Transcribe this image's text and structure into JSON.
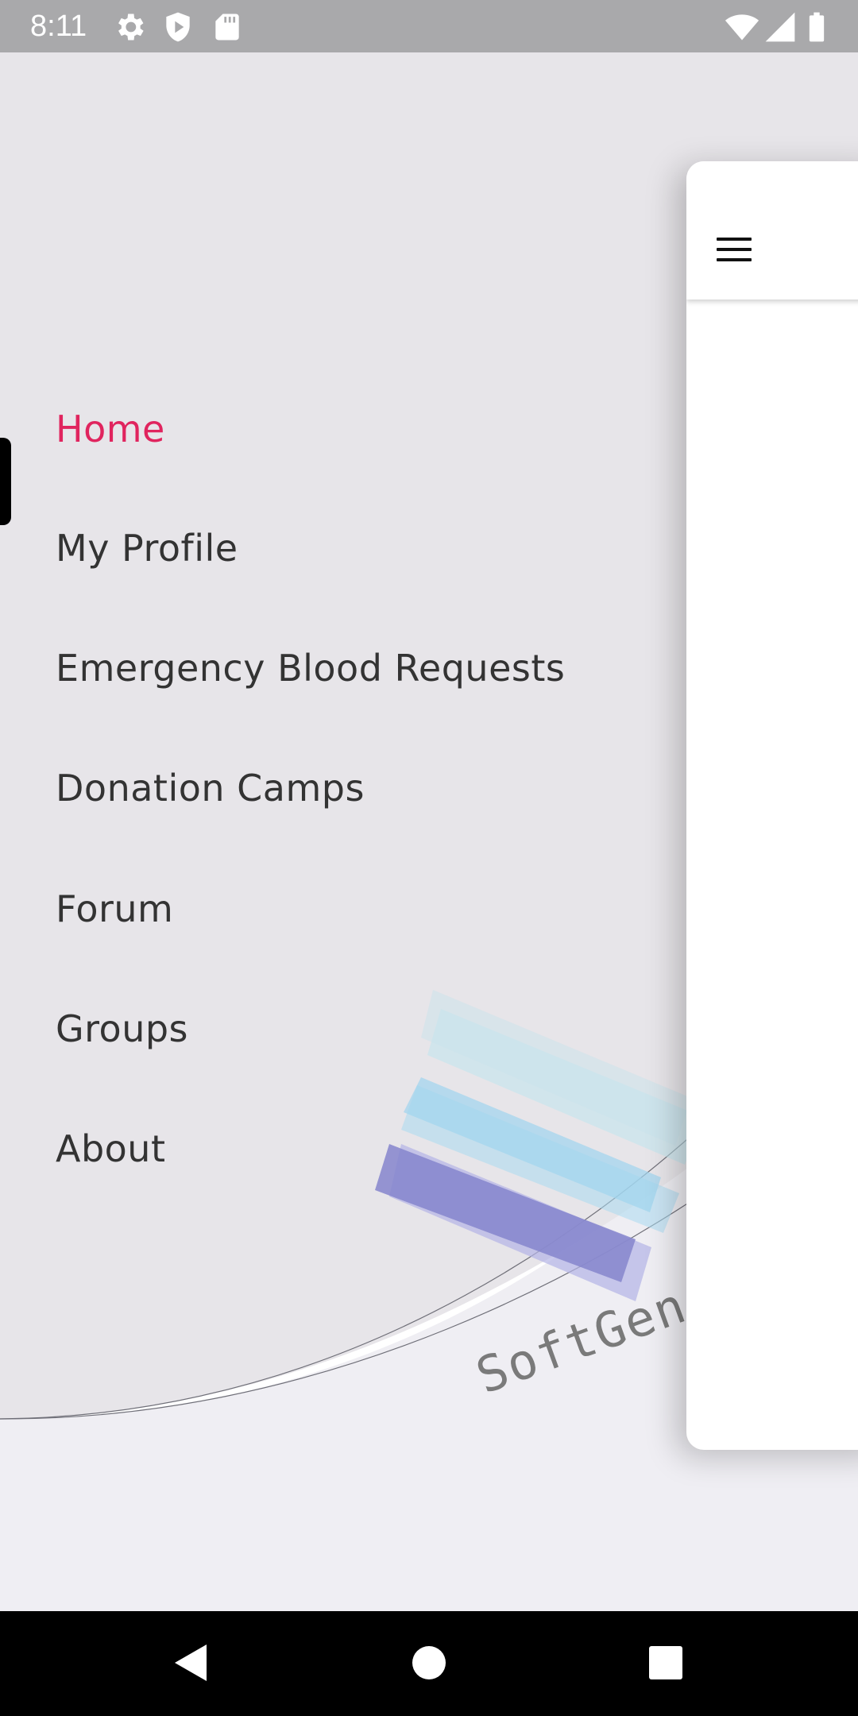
{
  "status_bar": {
    "time": "8:11",
    "left_icons": [
      "gear-icon",
      "shield-icon",
      "sd-card-icon"
    ],
    "right_icons": [
      "wifi-icon",
      "signal-icon",
      "battery-icon"
    ]
  },
  "drawer": {
    "items": [
      {
        "label": "Home",
        "active": true
      },
      {
        "label": "My Profile",
        "active": false
      },
      {
        "label": "Emergency Blood Requests",
        "active": false
      },
      {
        "label": "Donation Camps",
        "active": false
      },
      {
        "label": "Forum",
        "active": false
      },
      {
        "label": "Groups",
        "active": false
      },
      {
        "label": "About",
        "active": false
      }
    ],
    "active_color": "#e0245e",
    "background_color": "#e7e5e9"
  },
  "watermark": {
    "text": "SoftGen LK"
  },
  "main_card": {
    "menu_icon": "hamburger-menu-icon"
  },
  "system_nav": {
    "buttons": [
      "back-icon",
      "home-icon",
      "recents-icon"
    ]
  }
}
